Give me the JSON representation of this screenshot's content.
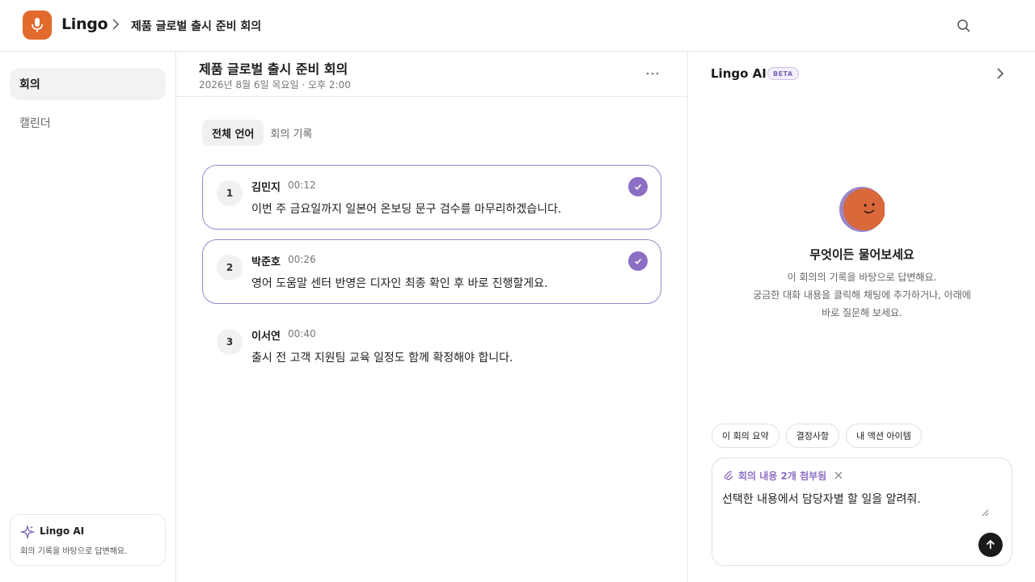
{
  "header": {
    "brand": "Lingo",
    "breadcrumb": "제품 글로벌 출시 준비 회의",
    "icons": {
      "logo": "microphone-icon",
      "separator": "chevron-right-icon",
      "search": "search-icon"
    },
    "brand_color": "#e26a2c"
  },
  "sidebar": {
    "items": [
      {
        "label": "회의",
        "active": true
      },
      {
        "label": "캘린더",
        "active": false
      }
    ],
    "ai_card": {
      "title": "Lingo AI",
      "description": "회의 기록을 바탕으로 답변해요.",
      "icon": "sparkle-icon"
    }
  },
  "main": {
    "title": "제품 글로벌 출시 준비 회의",
    "subtitle": "2026년 8월 6일 목요일 · 오후 2:00",
    "more_icon": "more-horizontal-icon",
    "tabs": [
      {
        "label": "전체 언어",
        "active": true
      },
      {
        "label": "회의 기록",
        "active": false
      }
    ],
    "transcript": [
      {
        "index": "1",
        "speaker": "김민지",
        "time": "00:12",
        "text": "이번 주 금요일까지 일본어 온보딩 문구 검수를 마무리하겠습니다.",
        "selected": true
      },
      {
        "index": "2",
        "speaker": "박준호",
        "time": "00:26",
        "text": "영어 도움말 센터 반영은 디자인 최종 확인 후 바로 진행할게요.",
        "selected": true
      },
      {
        "index": "3",
        "speaker": "이서연",
        "time": "00:40",
        "text": "출시 전 고객 지원팀 교육 일정도 함께 확정해야 합니다.",
        "selected": false
      }
    ],
    "accent_color": "#8c6fc4"
  },
  "panel": {
    "title": "Lingo AI",
    "badge": "BETA",
    "collapse_icon": "chevron-right-icon",
    "empty_state": {
      "avatar_icon": "smiling-avatar-icon",
      "title": "무엇이든 물어보세요",
      "lines": [
        "이 회의의 기록을 바탕으로 답변해요.",
        "궁금한 대화 내용을 클릭해 채팅에 추가하거나, 아래에",
        "바로 질문해 보세요."
      ]
    },
    "suggestions": [
      "이 회의 요약",
      "결정사항",
      "내 액션 아이템"
    ],
    "composer": {
      "attachment": "회의 내용 2개 첨부됨",
      "attachment_icon": "paperclip-icon",
      "remove_icon": "close-icon",
      "value": "선택한 내용에서 담당자별 할 일을 알려줘.",
      "send_icon": "arrow-up-icon"
    }
  }
}
